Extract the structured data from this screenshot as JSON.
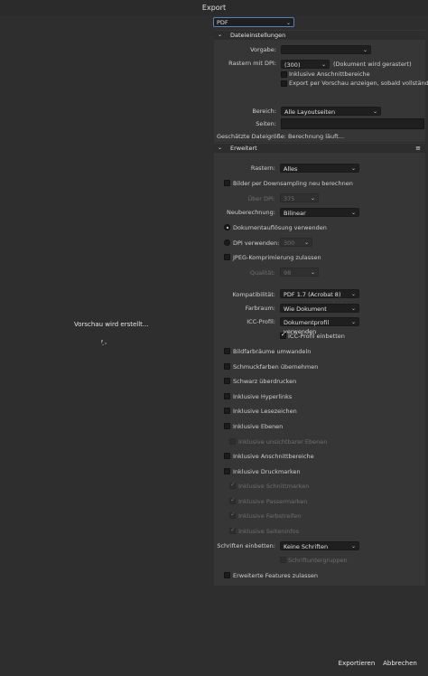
{
  "window": {
    "title": "Export"
  },
  "preview": {
    "status_text": "Vorschau wird erstellt..."
  },
  "format": {
    "value": "PDF"
  },
  "file_settings": {
    "header": "Dateieinstellungen",
    "preset_label": "Vorgabe:",
    "preset_value": "",
    "raster_dpi_label": "Rastern mit DPI:",
    "raster_dpi_value": "(300)",
    "raster_dpi_note": "(Dokument wird gerastert)",
    "include_bleed_label": "Inklusive Anschnittbereiche",
    "export_preview_label": "Export per Vorschau anzeigen, sobald vollständig",
    "area_label": "Bereich:",
    "area_value": "Alle Layoutseiten",
    "pages_label": "Seiten:",
    "pages_value": "",
    "estimated_size": "Geschätzte Dateigröße: Berechnung läuft..."
  },
  "advanced": {
    "header": "Erweitert",
    "raster_label": "Rastern:",
    "raster_value": "Alles",
    "downsample_label": "Bilder per Downsampling neu berechnen",
    "over_dpi_label": "Über DPI:",
    "over_dpi_value": "375",
    "resample_label": "Neuberechnung:",
    "resample_value": "Bilinear",
    "doc_resolution_label": "Dokumentauflösung verwenden",
    "dpi_use_label": "DPI verwenden:",
    "dpi_use_value": "300",
    "jpeg_label": "JPEG-Komprimierung zulassen",
    "quality_label": "Qualität:",
    "quality_value": "98",
    "compat_label": "Kompatibilität:",
    "compat_value": "PDF 1.7 (Acrobat 8)",
    "colorspace_label": "Farbraum:",
    "colorspace_value": "Wie Dokument",
    "icc_label": "ICC-Profil:",
    "icc_value": "Dokumentprofil verwenden",
    "icc_embed_label": "ICC-Profil einbetten",
    "convert_image_colorspaces": "Bildfarbräume umwandeln",
    "spot_colors": "Schmuckfarben übernehmen",
    "overprint_black": "Schwarz überdrucken",
    "include_hyperlinks": "Inklusive Hyperlinks",
    "include_bookmarks": "Inklusive Lesezeichen",
    "include_layers": "Inklusive Ebenen",
    "include_hidden_layers": "Inklusive unsichtbarer Ebenen",
    "include_bleed": "Inklusive Anschnittbereiche",
    "include_printer_marks": "Inklusive Druckmarken",
    "crop_marks": "Inklusive Schnittmarken",
    "registration_marks": "Inklusive Passermarken",
    "color_bars": "Inklusive Farbstreifen",
    "page_info": "Inklusive Seiteninfos",
    "embed_fonts_label": "Schriften einbetten:",
    "embed_fonts_value": "Keine Schriften",
    "font_subsets": "Schriftuntergruppen",
    "advanced_features": "Erweiterte Features zulassen"
  },
  "footer": {
    "export_label": "Exportieren",
    "cancel_label": "Abbrechen"
  }
}
